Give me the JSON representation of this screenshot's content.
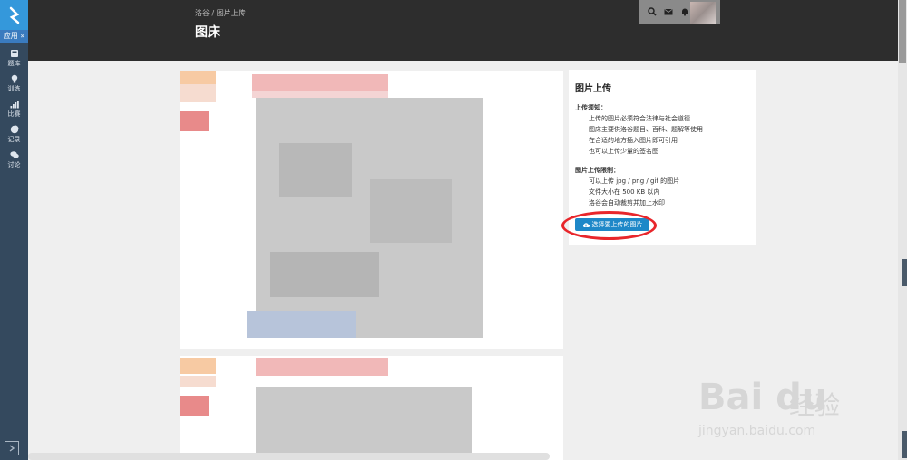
{
  "sidebar": {
    "app_label": "应用 »",
    "items": [
      {
        "label": "题库",
        "icon": "book-icon"
      },
      {
        "label": "训练",
        "icon": "lightbulb-icon"
      },
      {
        "label": "比赛",
        "icon": "signal-bars-icon"
      },
      {
        "label": "记录",
        "icon": "pie-chart-icon"
      },
      {
        "label": "讨论",
        "icon": "comments-icon"
      }
    ]
  },
  "header": {
    "breadcrumb": "洛谷 / 图片上传",
    "title": "图床"
  },
  "upload_panel": {
    "title": "图片上传",
    "notice_title": "上传须知：",
    "notice_lines": [
      "上传的图片必须符合法律与社会道德",
      "图床主要供洛谷题目、百科、题解等使用",
      "在合适的地方插入图片即可引用",
      "也可以上传少量的签名图"
    ],
    "limits_title": "图片上传限制：",
    "limits_lines": [
      "可以上传 jpg / png / gif 的图片",
      "文件大小在 500 KB 以内",
      "洛谷会自动裁剪并加上水印"
    ],
    "button_label": "选择要上传的图片"
  },
  "watermark": {
    "logo": "Bai du",
    "text": "经验",
    "url": "jingyan.baidu.com"
  },
  "colors": {
    "sidebar_bg": "#34495e",
    "logo_bg": "#3498db",
    "header_bg": "#2d2d2d",
    "button_bg": "#1e88c8",
    "highlight": "#e8262b"
  }
}
